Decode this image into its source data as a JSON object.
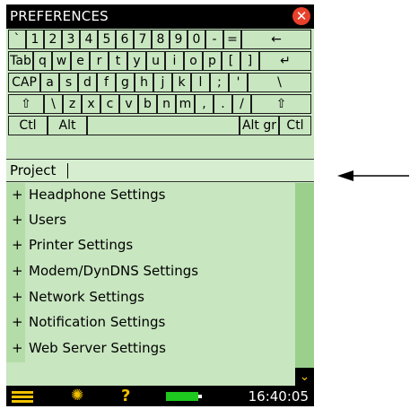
{
  "window": {
    "title": "PREFERENCES"
  },
  "keyboard": {
    "row1": [
      "`",
      "1",
      "2",
      "3",
      "4",
      "5",
      "6",
      "7",
      "8",
      "9",
      "0",
      "-",
      "=",
      "←"
    ],
    "row2": [
      "Tab",
      "q",
      "w",
      "e",
      "r",
      "t",
      "y",
      "u",
      "i",
      "o",
      "p",
      "[",
      "]",
      "↵"
    ],
    "row3": [
      "CAP",
      "a",
      "s",
      "d",
      "f",
      "g",
      "h",
      "j",
      "k",
      "l",
      ";",
      "'",
      "\\"
    ],
    "row4": [
      "⇧",
      "\\",
      "z",
      "x",
      "c",
      "v",
      "b",
      "n",
      "m",
      ",",
      ".",
      "/",
      "⇧"
    ],
    "row5": [
      "Ctl",
      "Alt",
      "",
      "Alt gr",
      "Ctl"
    ]
  },
  "input": {
    "value": "Project"
  },
  "list": {
    "plus": "+",
    "items": [
      "Headphone Settings",
      "Users",
      "Printer Settings",
      "Modem/DynDNS Settings",
      "Network Settings",
      "Notification Settings",
      "Web Server Settings"
    ]
  },
  "status": {
    "time": "16:40:05"
  },
  "icons": {
    "close": "close-icon",
    "menu": "menu-icon",
    "backlight": "backlight-icon",
    "help": "help-icon",
    "battery": "battery-icon",
    "scroll_down": "chevron-down-icon",
    "pointer": "arrow-pointer"
  },
  "colors": {
    "panel": "#c8e6c0",
    "accent": "#f2c000",
    "close": "#e8402a",
    "battery": "#1ec81e"
  }
}
